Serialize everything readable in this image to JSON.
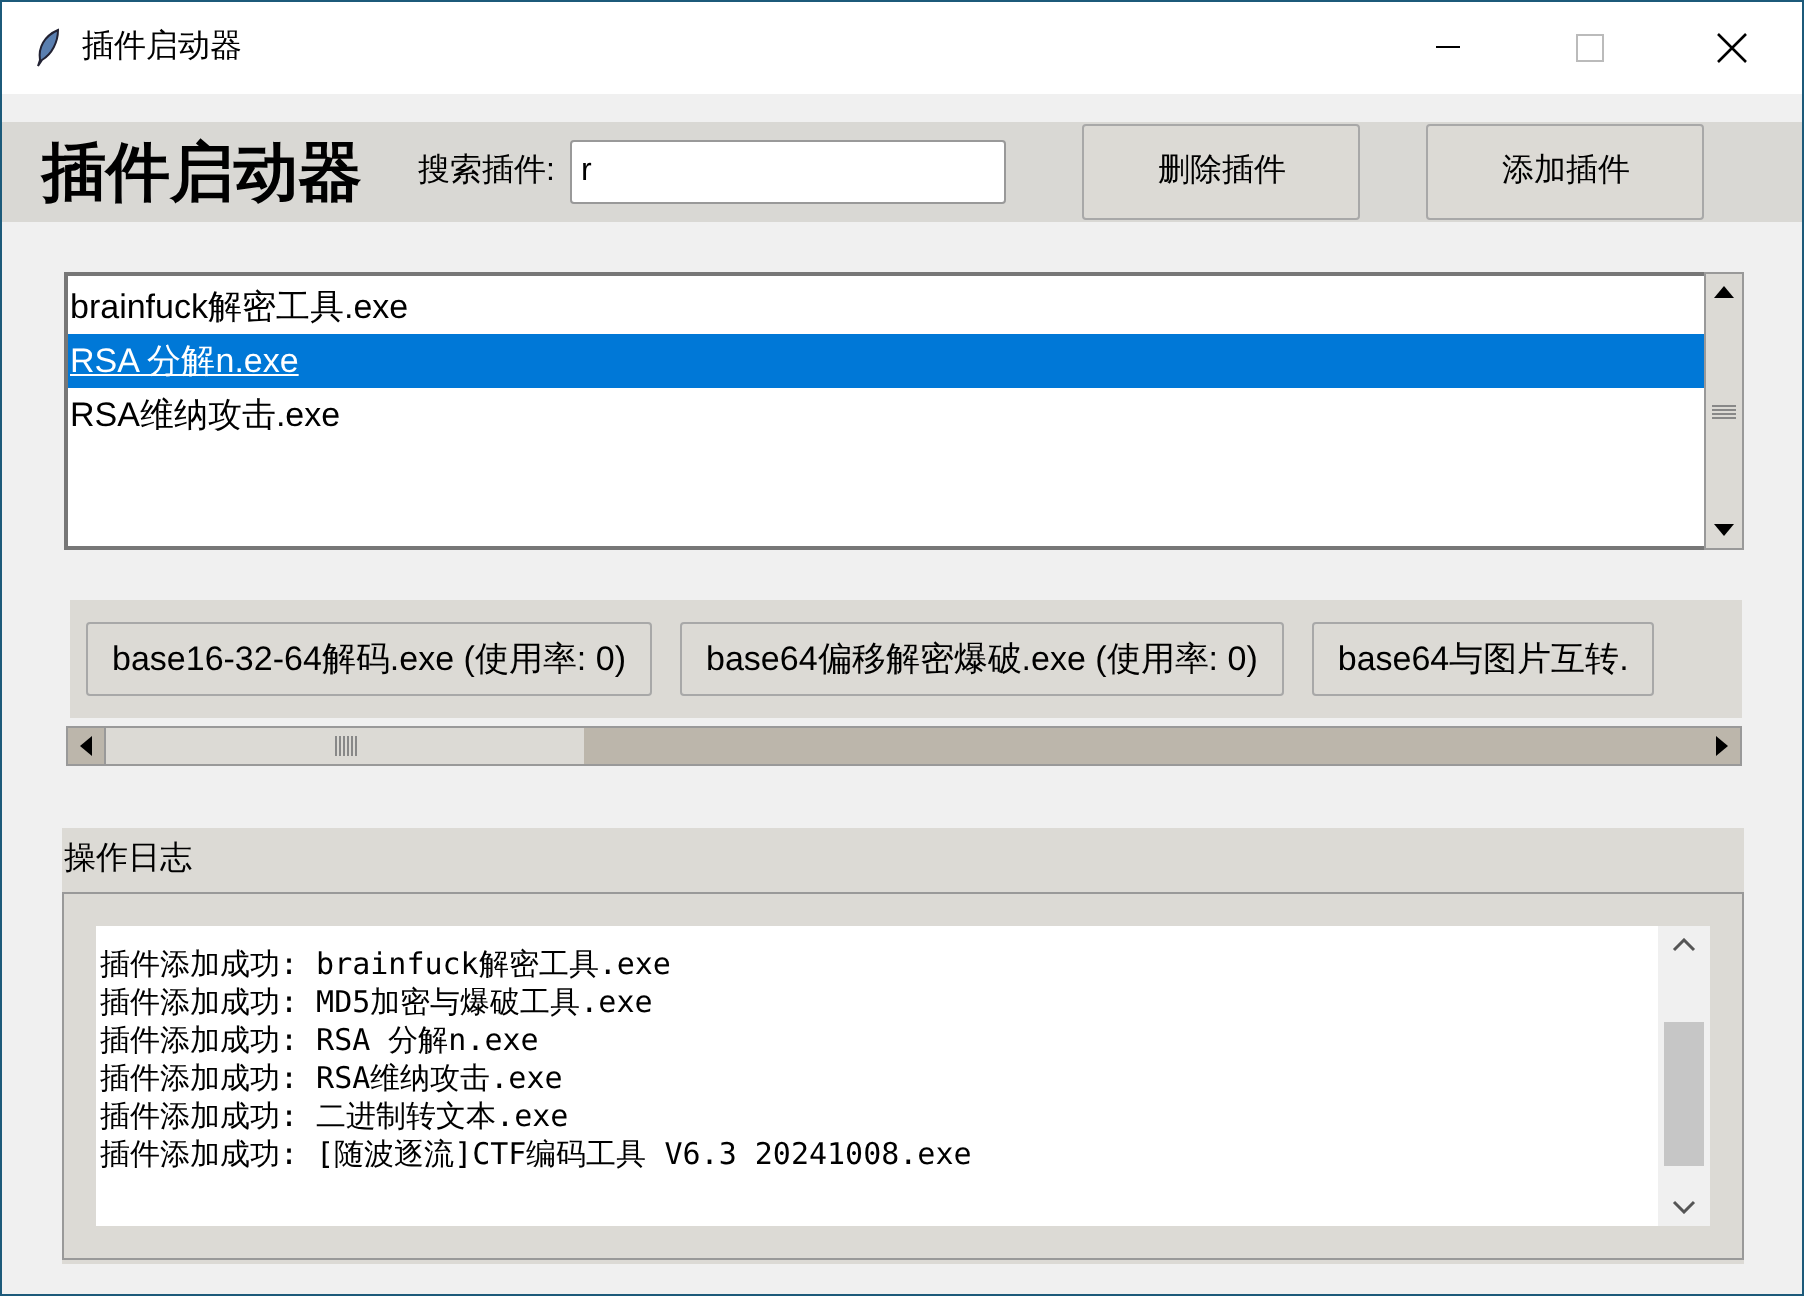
{
  "window": {
    "title": "插件启动器"
  },
  "header": {
    "title": "插件启动器",
    "search_label": "搜索插件:",
    "search_value": "r",
    "buttons": [
      "删除插件",
      "添加插件"
    ]
  },
  "plugin_list": [
    {
      "label": "brainfuck解密工具.exe",
      "selected": false
    },
    {
      "label": "RSA 分解n.exe",
      "selected": true
    },
    {
      "label": "RSA维纳攻击.exe",
      "selected": false
    }
  ],
  "plugin_buttons": [
    "base16-32-64解码.exe (使用率: 0)",
    "base64偏移解密爆破.exe (使用率: 0)",
    "base64与图片互转."
  ],
  "log": {
    "title": "操作日志",
    "lines": [
      "插件添加成功: brainfuck解密工具.exe",
      "插件添加成功: MD5加密与爆破工具.exe",
      "插件添加成功: RSA 分解n.exe",
      "插件添加成功: RSA维纳攻击.exe",
      "插件添加成功: 二进制转文本.exe",
      "插件添加成功: [随波逐流]CTF编码工具 V6.3 20241008.exe"
    ]
  }
}
